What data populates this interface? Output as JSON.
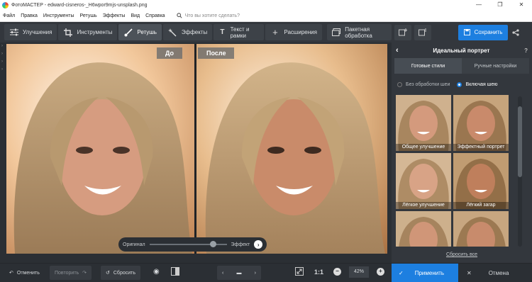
{
  "window": {
    "title": "ФотоМАСТЕР - edward-cisneros-_H6wpor9mjs-unsplash.png"
  },
  "menu": {
    "items": [
      "Файл",
      "Правка",
      "Инструменты",
      "Ретушь",
      "Эффекты",
      "Вид",
      "Справка"
    ],
    "search_placeholder": "Что вы хотите сделать?"
  },
  "toolbar": {
    "tabs": [
      {
        "label": "Улучшения",
        "icon": "sliders-icon",
        "active": false
      },
      {
        "label": "Инструменты",
        "icon": "crop-icon",
        "active": false
      },
      {
        "label": "Ретушь",
        "icon": "brush-icon",
        "active": true
      },
      {
        "label": "Эффекты",
        "icon": "magic-icon",
        "active": false
      },
      {
        "label": "Текст и рамки",
        "icon": "text-icon",
        "active": false
      },
      {
        "label": "Расширения",
        "icon": "plus-icon",
        "active": false
      },
      {
        "label": "Пакетная обработка",
        "icon": "batch-icon",
        "active": false
      }
    ]
  },
  "header_right": {
    "save_label": "Сохранить"
  },
  "canvas": {
    "before_label": "До",
    "after_label": "После",
    "compare_slider": {
      "left_label": "Оригинал",
      "right_label": "Эффект",
      "value_fraction": 0.8
    }
  },
  "panel": {
    "title": "Идеальный портрет",
    "tabs": [
      "Готовые стили",
      "Ручные настройки"
    ],
    "radio_without": "Без обработки шеи",
    "radio_with": "Включая шею",
    "presets": [
      "Общее улучшение",
      "Эффектный портрет",
      "Лёгкое улучшение",
      "Лёгкий загар",
      "",
      ""
    ],
    "reset_all": "Сбросить все"
  },
  "bottom": {
    "undo": "Отменить",
    "redo": "Повторить",
    "reset": "Сбросить",
    "zoom": "42%",
    "apply": "Применить",
    "cancel": "Отмена",
    "one_to_one": "1:1"
  },
  "colors": {
    "accent": "#1d7fe0",
    "panel": "#33373d",
    "background": "#2b2f34"
  }
}
